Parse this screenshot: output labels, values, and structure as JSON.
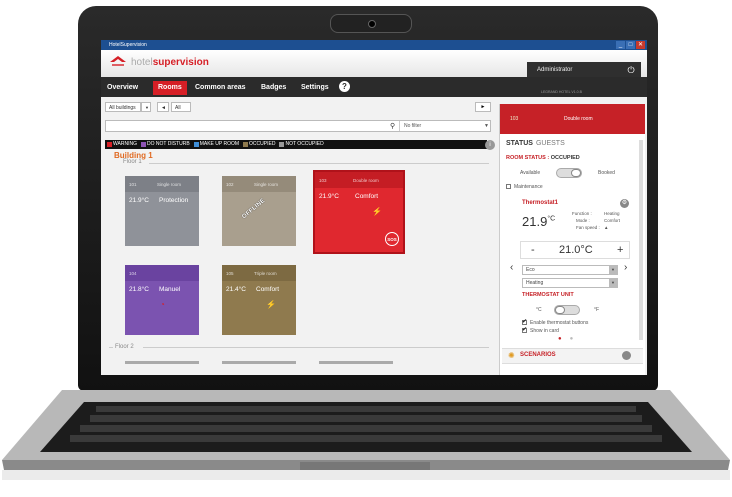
{
  "window": {
    "title": "HotelSupervision",
    "min": "_",
    "max": "□",
    "close": "✕"
  },
  "brand": {
    "prefix": "hotel",
    "name": "supervision"
  },
  "user": {
    "name": "Administrator",
    "power_icon": "power-icon"
  },
  "nav": {
    "tabs": [
      "Overview",
      "Rooms",
      "Common areas",
      "Badges",
      "Settings"
    ],
    "active": "Rooms",
    "help": "?"
  },
  "version": "LEGRAND HOTEL V1.0.B",
  "filters": {
    "building": "All buildings",
    "all": "All",
    "prev": "◄",
    "next": "►"
  },
  "search": {
    "placeholder": "",
    "filter": "No filter"
  },
  "legend": [
    {
      "label": "WARNING",
      "color": "#d61f26"
    },
    {
      "label": "DO NOT DISTURB",
      "color": "#8e54b4"
    },
    {
      "label": "MAKE UP ROOM",
      "color": "#3f8fd8"
    },
    {
      "label": "OCCUPIED",
      "color": "#8f7a4e"
    },
    {
      "label": "NOT OCCUPIED",
      "color": "#9a9a9a"
    }
  ],
  "building": "Building 1",
  "floors": [
    "Floor 1",
    "Floor 2"
  ],
  "rooms": [
    {
      "num": "101",
      "type": "Single room",
      "temp": "21.9°C",
      "mode": "Protection",
      "color": "#8f9299"
    },
    {
      "num": "102",
      "type": "Single room",
      "temp": "",
      "mode": "",
      "color": "#a99f8e",
      "overlay": "OFFLINE"
    },
    {
      "num": "103",
      "type": "Double room",
      "temp": "21.9°C",
      "mode": "Comfort",
      "color": "#e0282f",
      "sos": "SOS"
    },
    {
      "num": "104",
      "type": "",
      "temp": "21.8°C",
      "mode": "Manuel",
      "color": "#7b53b0"
    },
    {
      "num": "105",
      "type": "Triple room",
      "temp": "21.4°C",
      "mode": "Comfort",
      "color": "#8f7a4e"
    }
  ],
  "side": {
    "room_num": "103",
    "room_type": "Double room",
    "tab_status": "STATUS",
    "tab_guests": "GUESTS",
    "room_status_label": "ROOM STATUS :",
    "room_status_value": "OCCUPIED",
    "available": "Available",
    "booked": "Booked",
    "maintenance": "Maintenance",
    "thermostat": "Thermostat1",
    "temp": "21.9",
    "temp_unit": "°C",
    "function_k": "Function :",
    "function_v": "Heating",
    "mode_k": "Mode :",
    "mode_v": "Comfort",
    "fan_k": "Fan speed :",
    "fan_v": "▲",
    "minus": "-",
    "plus": "+",
    "setpoint": "21.0°C",
    "eco": "Eco",
    "heating": "Heating",
    "unit_title": "THERMOSTAT UNIT",
    "unit_c": "°C",
    "unit_f": "°F",
    "enable_buttons": "Enable thermostat buttons",
    "show_in_card": "Show in card",
    "scenarios": "SCENARIOS"
  }
}
